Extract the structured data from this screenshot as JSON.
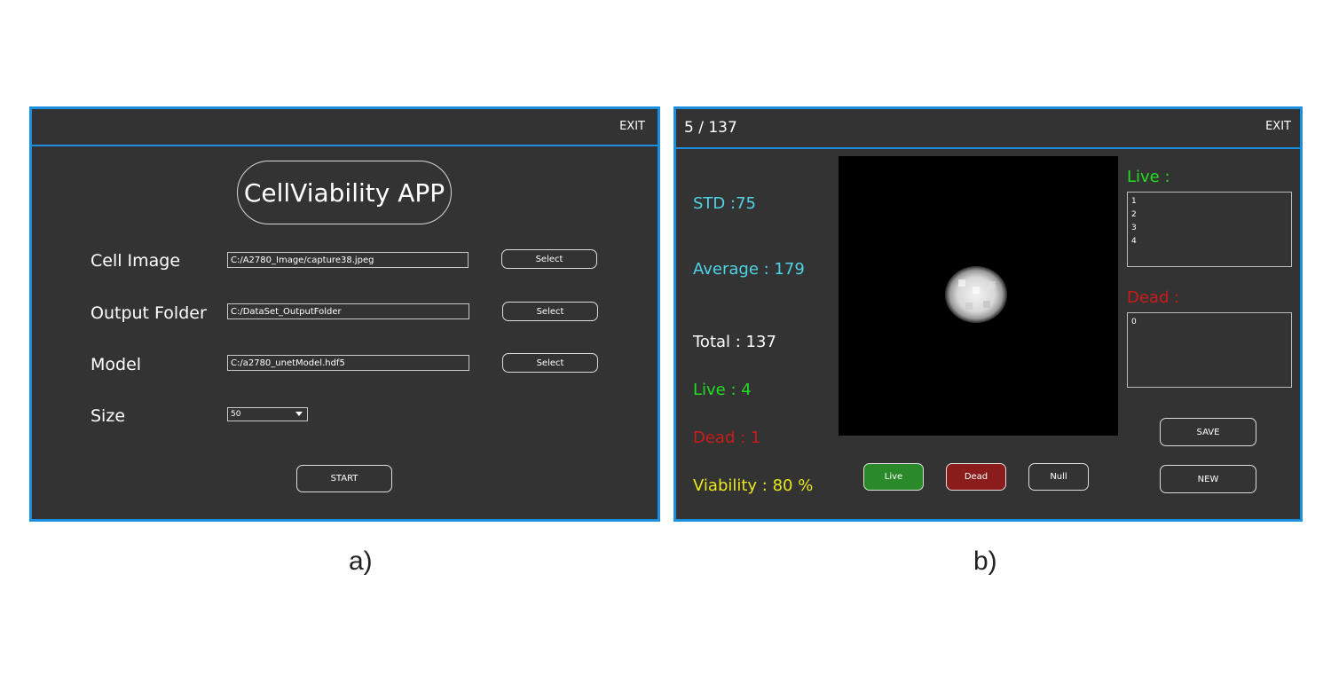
{
  "panel_a": {
    "exit_label": "EXIT",
    "app_title": "CellViability APP",
    "fields": [
      {
        "label": "Cell Image",
        "value": "C:/A2780_Image/capture38.jpeg",
        "button": "Select"
      },
      {
        "label": "Output Folder",
        "value": "C:/DataSet_OutputFolder",
        "button": "Select"
      },
      {
        "label": "Model",
        "value": "C:/a2780_unetModel.hdf5",
        "button": "Select"
      }
    ],
    "size_label": "Size",
    "size_value": "50",
    "start_label": "START"
  },
  "panel_b": {
    "counter": "5 / 137",
    "exit_label": "EXIT",
    "std": "STD :75",
    "average": "Average : 179",
    "total": "Total : 137",
    "live": "Live : 4",
    "dead": "Dead : 1",
    "viability": "Viability : 80 %",
    "buttons": {
      "live": "Live",
      "dead": "Dead",
      "null": "Null",
      "save": "SAVE",
      "new": "NEW"
    },
    "live_list_label": "Live :",
    "live_list": [
      "1",
      "2",
      "3",
      "4"
    ],
    "dead_list_label": "Dead :",
    "dead_list": [
      "0"
    ]
  },
  "captions": {
    "a": "a)",
    "b": "b)"
  },
  "colors": {
    "window_bg": "#333333",
    "border_accent": "#1a8fe0",
    "stat_cyan": "#4fd3e6",
    "live_green": "#22dd22",
    "dead_red": "#cc1a1a",
    "viability_yellow": "#e8e81a",
    "live_button": "#2a8a2a",
    "dead_button": "#8a1c1c"
  }
}
